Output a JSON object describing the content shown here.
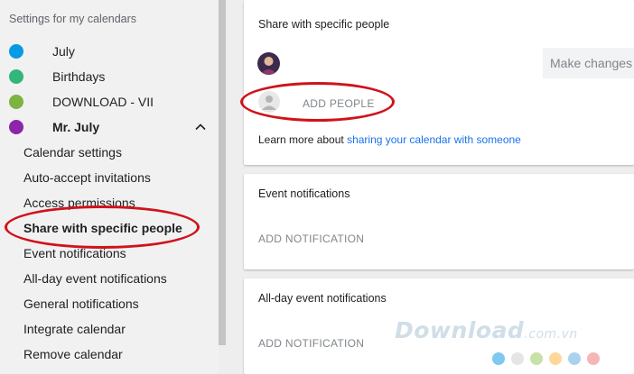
{
  "sidebar": {
    "heading": "Settings for my calendars",
    "calendars": [
      {
        "label": "July",
        "color": "#039be5"
      },
      {
        "label": "Birthdays",
        "color": "#33b679"
      },
      {
        "label": "DOWNLOAD - VII",
        "color": "#7cb342"
      },
      {
        "label": "Mr. July",
        "color": "#8e24aa"
      }
    ],
    "sub_items": [
      "Calendar settings",
      "Auto-accept invitations",
      "Access permissions",
      "Share with specific people",
      "Event notifications",
      "All-day event notifications",
      "General notifications",
      "Integrate calendar",
      "Remove calendar"
    ]
  },
  "share_card": {
    "title": "Share with specific people",
    "permission_select": "Make changes",
    "add_people": "ADD PEOPLE",
    "learn_more_prefix": "Learn more about ",
    "learn_more_link": "sharing your calendar with someone"
  },
  "event_card": {
    "title": "Event notifications",
    "add_notification": "ADD NOTIFICATION"
  },
  "allday_card": {
    "title": "All-day event notifications",
    "add_notification": "ADD NOTIFICATION"
  },
  "watermark": {
    "text": "Download",
    "suffix": ".com.vn",
    "dot_colors": [
      "#7fc8f0",
      "#e5e5e5",
      "#c6e2a8",
      "#ffd79a",
      "#a9d2ee",
      "#f6b6b6"
    ]
  },
  "colors": {
    "accent_link": "#1a73e8",
    "highlight_ellipse": "#d0121b"
  }
}
